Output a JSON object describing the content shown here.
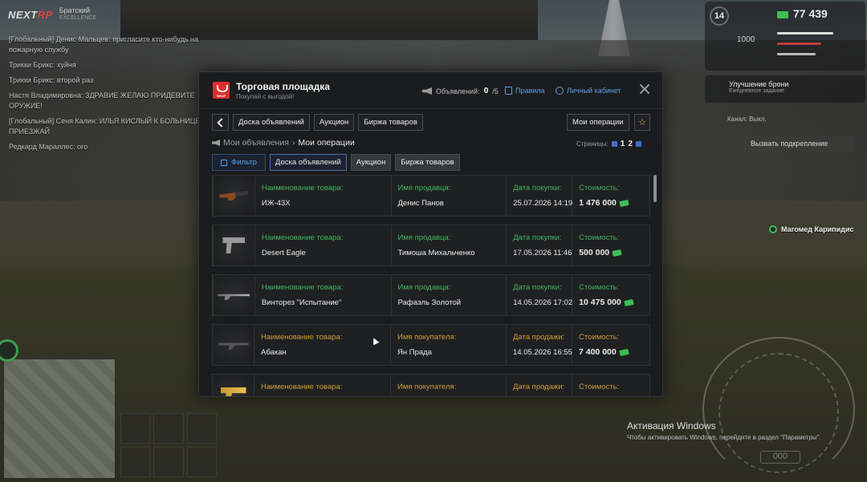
{
  "hud": {
    "brand_a": "NEXT",
    "brand_b": "RP",
    "server_name": "Братский",
    "server_sub": "EXCELLENCE",
    "level": "14",
    "money": "77 439",
    "stat_1000": "1000",
    "upgrade_title": "Улучшение брони",
    "upgrade_sub": "Ежедневное задание",
    "channel_label": "Канал: Выкл.",
    "reinforce_label": "Вызвать подкрепление",
    "player_name": "Магомед Карипидис",
    "speed_digits": "000"
  },
  "chat": [
    "[Глобальный] Денис Мальцев: пригласите кто-нибудь на пожарную службу",
    "Трикки Брикс: хуйня",
    "Трикки Брикс: второй раз",
    "Настя Владимировна: ЗДРАВИЕ ЖЕЛАЮ ПРИДЕВИТЕ ОРУЖИЕ!",
    "[Глобальный] Сеня Калин: ИЛЬЯ КИСЛЫЙ К БОЛЬНИЦЕ ПРИЕЗЖАЙ",
    "Редкард Мараллес: ого"
  ],
  "windows_activation": {
    "title": "Активация Windows",
    "subtitle": "Чтобы активировать Windows, перейдите в раздел \"Параметры\"."
  },
  "modal": {
    "title": "Торговая площадка",
    "subtitle": "Покупай с выгодой!",
    "shop_badge": "SHOP",
    "ads_label": "Объявлений:",
    "ads_count": "0",
    "ads_max": "/5",
    "rules": "Правила",
    "cabinet": "Личный кабинет",
    "nav": {
      "board": "Доска объявлений",
      "auction": "Аукцион",
      "exchange": "Биржа товаров",
      "my_operations": "Мои операции",
      "star": "☆"
    },
    "breadcrumb": {
      "root": "Мои объявления",
      "sep": "›",
      "current": "Мои операции"
    },
    "pages_label": "Страницы:",
    "pages": [
      "1",
      "2"
    ],
    "filter": {
      "filter": "Фильтр",
      "board": "Доска объявлений",
      "auction": "Аукцион",
      "exchange": "Биржа товаров"
    },
    "rows": [
      {
        "icon": "shotgun",
        "type": "purchase",
        "item_label": "Наименование товара:",
        "item": "ИЖ-43Х",
        "party_label": "Имя продавца:",
        "party": "Денис Панов",
        "date_label": "Дата покупки:",
        "date": "25.07.2026 14:19",
        "price_label": "Стоимость:",
        "price": "1 476 000"
      },
      {
        "icon": "pistol",
        "type": "purchase",
        "item_label": "Наименование товара:",
        "item": "Desert Eagle",
        "party_label": "Имя продавца:",
        "party": "Тимоша Михальченко",
        "date_label": "Дата покупки:",
        "date": "17.05.2026 11:46",
        "price_label": "Стоимость:",
        "price": "500 000"
      },
      {
        "icon": "sniper",
        "type": "purchase",
        "item_label": "Наименование товара:",
        "item": "Винторез \"Испытание\"",
        "party_label": "Имя продавца:",
        "party": "Рафаэль Золотой",
        "date_label": "Дата покупки:",
        "date": "14.05.2026 17:02",
        "price_label": "Стоимость:",
        "price": "10 475 000"
      },
      {
        "icon": "rifle",
        "type": "sale",
        "item_label": "Наименование товара:",
        "item": "Абакан",
        "party_label": "Имя покупателя:",
        "party": "Ян Прада",
        "date_label": "Дата продажи:",
        "date": "14.05.2026 16:55",
        "price_label": "Стоимость:",
        "price": "7 400 000"
      },
      {
        "icon": "gold",
        "type": "sale",
        "item_label": "Наименование товара:",
        "item": "",
        "party_label": "Имя покупателя:",
        "party": "",
        "date_label": "Дата продажи:",
        "date": "",
        "price_label": "Стоимость:",
        "price": ""
      }
    ]
  }
}
